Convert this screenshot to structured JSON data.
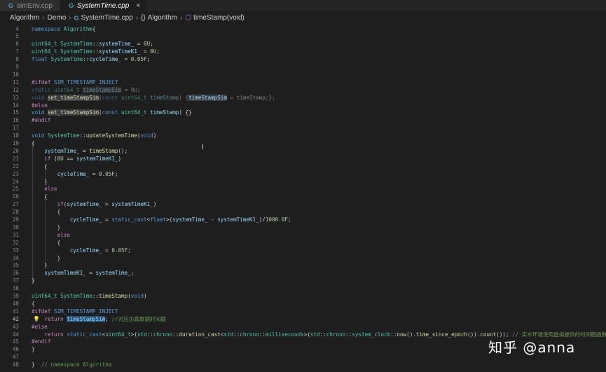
{
  "tabs": [
    {
      "label": "simEnv.cpp",
      "icon": "cpp-file-icon",
      "active": false
    },
    {
      "label": "SystemTime.cpp",
      "icon": "cpp-file-icon",
      "active": true
    }
  ],
  "tab_icon_glyph": "G",
  "close_glyph": "×",
  "breadcrumb": {
    "folder1": "Algorithm",
    "folder2": "Demo",
    "file": "SystemTime.cpp",
    "namespace_glyph": "{}",
    "namespace": "Algorithm",
    "func": "timeStamp(void)",
    "sep": "›"
  },
  "current_line": "42",
  "lines": [
    {
      "n": "4"
    },
    {
      "n": "5"
    },
    {
      "n": "6"
    },
    {
      "n": "7"
    },
    {
      "n": "8"
    },
    {
      "n": "9"
    },
    {
      "n": "10"
    },
    {
      "n": "11"
    },
    {
      "n": "12"
    },
    {
      "n": "13"
    },
    {
      "n": "14"
    },
    {
      "n": "15"
    },
    {
      "n": "16"
    },
    {
      "n": "17"
    },
    {
      "n": "18"
    },
    {
      "n": "19"
    },
    {
      "n": "20"
    },
    {
      "n": "21"
    },
    {
      "n": "22"
    },
    {
      "n": "23"
    },
    {
      "n": "24"
    },
    {
      "n": "25"
    },
    {
      "n": "26"
    },
    {
      "n": "27"
    },
    {
      "n": "28"
    },
    {
      "n": "29"
    },
    {
      "n": "30"
    },
    {
      "n": "31"
    },
    {
      "n": "32"
    },
    {
      "n": "33"
    },
    {
      "n": "34"
    },
    {
      "n": "35"
    },
    {
      "n": "36"
    },
    {
      "n": "37"
    },
    {
      "n": "38"
    },
    {
      "n": "39"
    },
    {
      "n": "40"
    },
    {
      "n": "41"
    },
    {
      "n": "42"
    },
    {
      "n": "43"
    },
    {
      "n": "44"
    },
    {
      "n": "45"
    },
    {
      "n": "46"
    },
    {
      "n": "47"
    },
    {
      "n": "48"
    }
  ],
  "code": {
    "l5": [
      [
        "kw",
        "namespace "
      ],
      [
        "ty",
        "Algorithm"
      ],
      [
        "",
        "{"
      ]
    ],
    "l7": [
      [
        "ty",
        "uint64_t "
      ],
      [
        "ty",
        "SystemTime"
      ],
      [
        "",
        "::"
      ],
      [
        "vr",
        "systemTime_"
      ],
      [
        "",
        " = "
      ],
      [
        "num",
        "0U"
      ],
      [
        "",
        ";"
      ]
    ],
    "l8": [
      [
        "ty",
        "uint64_t "
      ],
      [
        "ty",
        "SystemTime"
      ],
      [
        "",
        "::"
      ],
      [
        "vr",
        "systemTimeK1_"
      ],
      [
        "",
        " = "
      ],
      [
        "num",
        "0U"
      ],
      [
        "",
        ";"
      ]
    ],
    "l9": [
      [
        "kw",
        "float "
      ],
      [
        "ty",
        "SystemTime"
      ],
      [
        "",
        "::"
      ],
      [
        "vr",
        "cycleTime_"
      ],
      [
        "",
        " = "
      ],
      [
        "num",
        "0.05F"
      ],
      [
        "",
        ";"
      ]
    ],
    "l12": [
      [
        "pp",
        "#ifdef "
      ],
      [
        "mac",
        "SIM_TIMESTAMP_INJECT"
      ]
    ],
    "l13": [
      [
        "kw dim",
        "static "
      ],
      [
        "ty dim",
        "uint64_t "
      ],
      [
        "vr dim hl",
        "timeStampSim"
      ],
      [
        "dim",
        " = "
      ],
      [
        "num dim",
        "0U"
      ],
      [
        "dim",
        ";"
      ]
    ],
    "l14": [
      [
        "kw dim",
        "void "
      ],
      [
        "fn hl",
        "set_timeStampSim"
      ],
      [
        "dim",
        "("
      ],
      [
        "kw dim",
        "const "
      ],
      [
        "ty dim",
        "uint64_t "
      ],
      [
        "vr dim",
        "timeStamp"
      ],
      [
        "dim",
        ") {"
      ],
      [
        "vr hl",
        "timeStampSim"
      ],
      [
        "dim",
        " = timeStamp;};"
      ]
    ],
    "l15": [
      [
        "pp",
        "#else"
      ]
    ],
    "l16": [
      [
        "kw",
        "void "
      ],
      [
        "fn hl",
        "set_timeStampSim"
      ],
      [
        "",
        "("
      ],
      [
        "kw",
        "const "
      ],
      [
        "ty",
        "uint64_t "
      ],
      [
        "vr",
        "timeStamp"
      ],
      [
        "",
        ") {}"
      ]
    ],
    "l17": [
      [
        "pp",
        "#endif"
      ]
    ],
    "l19": [
      [
        "kw",
        "void "
      ],
      [
        "ty",
        "SystemTime"
      ],
      [
        "",
        "::"
      ],
      [
        "fn",
        "updateSystemTime"
      ],
      [
        "",
        "("
      ],
      [
        "kw",
        "void"
      ],
      [
        "",
        ")"
      ]
    ],
    "l20": [
      [
        "",
        "{"
      ]
    ],
    "l21": [
      [
        "",
        "    "
      ],
      [
        "vr",
        "systemTime_"
      ],
      [
        "",
        " = "
      ],
      [
        "fn",
        "timeStamp"
      ],
      [
        "",
        "();"
      ]
    ],
    "l22": [
      [
        "",
        "    "
      ],
      [
        "pp",
        "if "
      ],
      [
        "",
        "("
      ],
      [
        "num",
        "0U"
      ],
      [
        "",
        " == "
      ],
      [
        "vr",
        "systemTimeK1_"
      ],
      [
        "",
        ")"
      ]
    ],
    "l23": [
      [
        "",
        "    {"
      ]
    ],
    "l24": [
      [
        "",
        "        "
      ],
      [
        "vr",
        "cycleTime_"
      ],
      [
        "",
        " = "
      ],
      [
        "num",
        "0.05F"
      ],
      [
        "",
        ";"
      ]
    ],
    "l25": [
      [
        "",
        "    }"
      ]
    ],
    "l26": [
      [
        "",
        "    "
      ],
      [
        "pp",
        "else"
      ]
    ],
    "l27": [
      [
        "",
        "    {"
      ]
    ],
    "l28": [
      [
        "",
        "        "
      ],
      [
        "pp",
        "if"
      ],
      [
        "",
        "("
      ],
      [
        "vr",
        "systemTime_"
      ],
      [
        "",
        " > "
      ],
      [
        "vr",
        "systemTimeK1_"
      ],
      [
        "",
        ")"
      ]
    ],
    "l29": [
      [
        "",
        "        {"
      ]
    ],
    "l30": [
      [
        "",
        "            "
      ],
      [
        "vr",
        "cycleTime_"
      ],
      [
        "",
        " = "
      ],
      [
        "kw",
        "static_cast"
      ],
      [
        "",
        "<"
      ],
      [
        "kw",
        "float"
      ],
      [
        "",
        ">("
      ],
      [
        "vr",
        "systemTime_"
      ],
      [
        "",
        " - "
      ],
      [
        "vr",
        "systemTimeK1_"
      ],
      [
        "",
        ")/"
      ],
      [
        "num",
        "1000.0F"
      ],
      [
        "",
        ";"
      ]
    ],
    "l31": [
      [
        "",
        "        }"
      ]
    ],
    "l32": [
      [
        "",
        "        "
      ],
      [
        "pp",
        "else"
      ]
    ],
    "l33": [
      [
        "",
        "        {"
      ]
    ],
    "l34": [
      [
        "",
        "            "
      ],
      [
        "vr",
        "cycleTime_"
      ],
      [
        "",
        " = "
      ],
      [
        "num",
        "0.05F"
      ],
      [
        "",
        ";"
      ]
    ],
    "l35": [
      [
        "",
        "        }"
      ]
    ],
    "l36": [
      [
        "",
        "    }"
      ]
    ],
    "l37": [
      [
        "",
        "    "
      ],
      [
        "vr",
        "systemTimeK1_"
      ],
      [
        "",
        " = "
      ],
      [
        "vr",
        "systemTime_"
      ],
      [
        "",
        ";"
      ]
    ],
    "l38": [
      [
        "",
        "}"
      ]
    ],
    "l40": [
      [
        "ty",
        "uint64_t "
      ],
      [
        "ty",
        "SystemTime"
      ],
      [
        "",
        "::"
      ],
      [
        "fn",
        "timeStamp"
      ],
      [
        "",
        "("
      ],
      [
        "kw",
        "void"
      ],
      [
        "",
        ")"
      ]
    ],
    "l41": [
      [
        "",
        "{"
      ]
    ],
    "l42": [
      [
        "pp",
        "#ifdef "
      ],
      [
        "mac",
        "SIM_TIMESTAMP_INJECT"
      ]
    ],
    "l43": [
      [
        "",
        "    "
      ],
      [
        "pp",
        "return "
      ],
      [
        "vr hl2",
        "timeStampSim"
      ],
      [
        "",
        ";"
      ],
      [
        "cm",
        " //对应仿真数据时间戳"
      ]
    ],
    "l44": [
      [
        "pp",
        "#else"
      ]
    ],
    "l45": [
      [
        "",
        "    "
      ],
      [
        "pp",
        "return "
      ],
      [
        "kw",
        "static_cast"
      ],
      [
        "",
        "<"
      ],
      [
        "ty",
        "uint64_t"
      ],
      [
        "",
        ">("
      ],
      [
        "ty",
        "std"
      ],
      [
        "",
        "::"
      ],
      [
        "ty",
        "chrono"
      ],
      [
        "",
        "::"
      ],
      [
        "fn",
        "duration_cast"
      ],
      [
        "",
        "<"
      ],
      [
        "ty",
        "std"
      ],
      [
        "",
        "::"
      ],
      [
        "ty",
        "chrono"
      ],
      [
        "",
        "::"
      ],
      [
        "ty",
        "milliseconds"
      ],
      [
        "",
        ">("
      ],
      [
        "ty",
        "std"
      ],
      [
        "",
        "::"
      ],
      [
        "ty",
        "chrono"
      ],
      [
        "",
        "::"
      ],
      [
        "ty",
        "system_clock"
      ],
      [
        "",
        "::"
      ],
      [
        "fn",
        "now"
      ],
      [
        "",
        "()."
      ],
      [
        "fn",
        "time_since_epoch"
      ],
      [
        "",
        "())."
      ],
      [
        "fn",
        "count"
      ],
      [
        "",
        "()); "
      ],
      [
        "cm",
        "// 实车环境使用虚拟提供的时间戳函数"
      ]
    ],
    "l46": [
      [
        "pp",
        "#endif"
      ]
    ],
    "l47": [
      [
        "",
        "}"
      ]
    ],
    "l49": [
      [
        "",
        "}  "
      ],
      [
        "cm",
        "// namespace Algorithm"
      ]
    ]
  },
  "watermark": "知乎 @anna",
  "bulb_glyph": "💡",
  "caret_glyph": "I"
}
